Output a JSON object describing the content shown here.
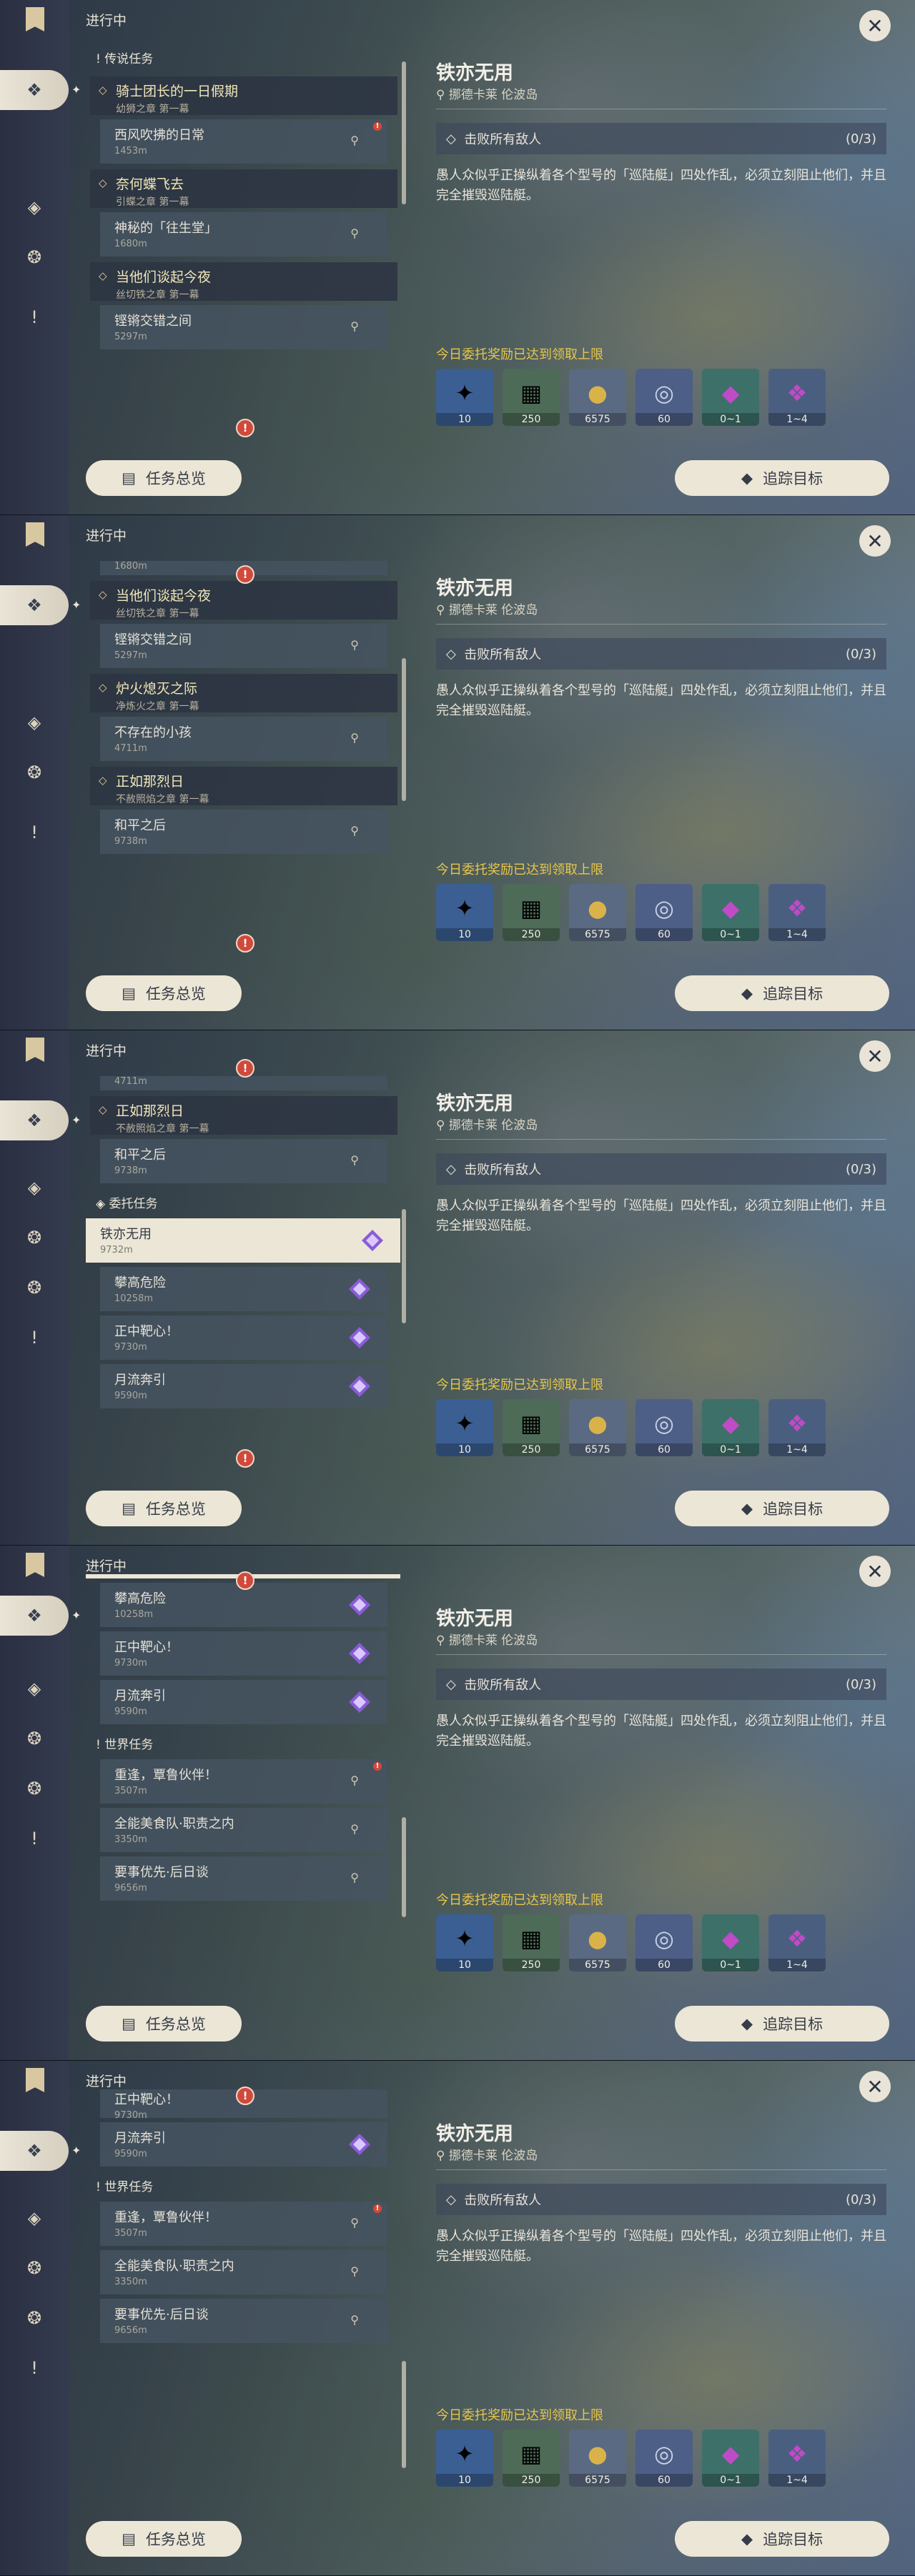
{
  "header": {
    "in_progress": "进行中",
    "close_label": "✕"
  },
  "rail_icons": [
    "bookmark-icon",
    "sparkle-diamond-icon",
    "diamond-icon",
    "compass-icon",
    "exclamation-icon"
  ],
  "buttons": {
    "overview": "任务总览",
    "track": "追踪目标"
  },
  "detail": {
    "title": "铁亦无用",
    "location": "挪德卡莱 伦波岛",
    "objective": "击败所有敌人",
    "objective_count": "(0/3)",
    "description": "愚人众似乎正操纵着各个型号的「巡陆艇」四处作乱，必须立刻阻止他们，并且完全摧毁巡陆艇。",
    "reward_note": "今日委托奖励已达到领取上限",
    "rewards": [
      {
        "icon": "star-icon",
        "count": "10",
        "color": "#3b5f93"
      },
      {
        "icon": "book-icon",
        "count": "250",
        "color": "#4d6b57"
      },
      {
        "icon": "mora-coin-icon",
        "count": "6575",
        "color": "#5a6a82"
      },
      {
        "icon": "friendship-icon",
        "count": "60",
        "color": "#4d5f86"
      },
      {
        "icon": "crystal-icon",
        "count": "0~1",
        "color": "#3d7069"
      },
      {
        "icon": "crystal-cluster-icon",
        "count": "1~4",
        "color": "#4a5f80"
      }
    ]
  },
  "categories": {
    "legend": "传说任务",
    "commission": "委托任务",
    "world": "世界任务"
  },
  "quests": {
    "q1": {
      "title": "骑士团长的一日假期",
      "sub": "幼狮之章 第一幕"
    },
    "q1a": {
      "title": "西风吹拂的日常",
      "dist": "1453m"
    },
    "q2": {
      "title": "奈何蝶飞去",
      "sub": "引蝶之章 第一幕"
    },
    "q2a": {
      "title": "神秘的「往生堂」",
      "dist": "1680m"
    },
    "q3": {
      "title": "当他们谈起今夜",
      "sub": "丝切铁之章 第一幕"
    },
    "q3a": {
      "title": "铿锵交错之间",
      "dist": "5297m"
    },
    "q4": {
      "title": "炉火熄灭之际",
      "sub": "净炼火之章 第一幕"
    },
    "q4a": {
      "title": "不存在的小孩",
      "dist": "4711m"
    },
    "q5": {
      "title": "正如那烈日",
      "sub": "不赦照焰之章 第一幕"
    },
    "q5a": {
      "title": "和平之后",
      "dist": "9738m"
    },
    "c1": {
      "title": "铁亦无用",
      "dist": "9732m"
    },
    "c2": {
      "title": "攀高危险",
      "dist": "10258m"
    },
    "c3": {
      "title": "正中靶心！",
      "dist": "9730m"
    },
    "c4": {
      "title": "月流奔引",
      "dist": "9590m"
    },
    "w1": {
      "title": "重逢，覃鲁伙伴！",
      "dist": "3507m"
    },
    "w2": {
      "title": "全能美食队·职责之内",
      "dist": "3350m"
    },
    "w3": {
      "title": "要事优先·后日谈",
      "dist": "9656m"
    },
    "peek_dist_1": "1680m",
    "peek_dist_2": "4711m"
  },
  "badge_glyph": "!"
}
